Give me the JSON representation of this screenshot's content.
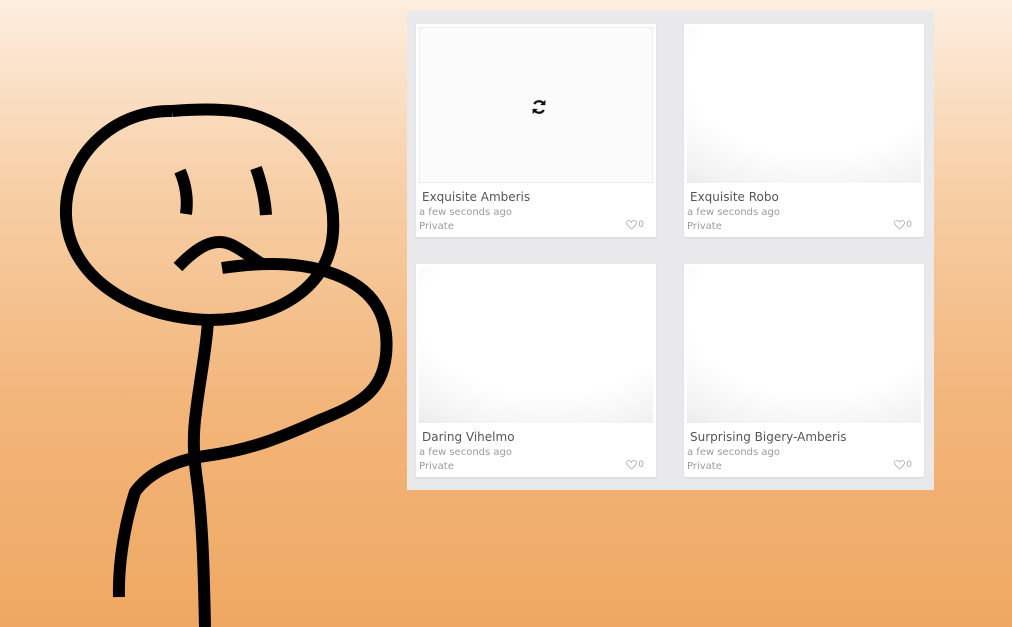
{
  "gallery": {
    "cards": [
      {
        "title": "Exquisite Amberis",
        "time": "a few seconds ago",
        "privacy": "Private",
        "likes": "0",
        "loading": true,
        "thumb_icon": "refresh-icon"
      },
      {
        "title": "Exquisite Robo",
        "time": "a few seconds ago",
        "privacy": "Private",
        "likes": "0",
        "loading": false
      },
      {
        "title": "Daring Vihelmo",
        "time": "a few seconds ago",
        "privacy": "Private",
        "likes": "0",
        "loading": false
      },
      {
        "title": "Surprising Bigery-Amberis",
        "time": "a few seconds ago",
        "privacy": "Private",
        "likes": "0",
        "loading": false
      }
    ]
  },
  "illustration": {
    "subject": "confused stick figure"
  },
  "colors": {
    "background_top": "#fdeee0",
    "background_bottom": "#efa862",
    "panel": "#e9e9eb",
    "card": "#ffffff",
    "title_text": "#555555",
    "meta_text": "#9a9a9a"
  }
}
